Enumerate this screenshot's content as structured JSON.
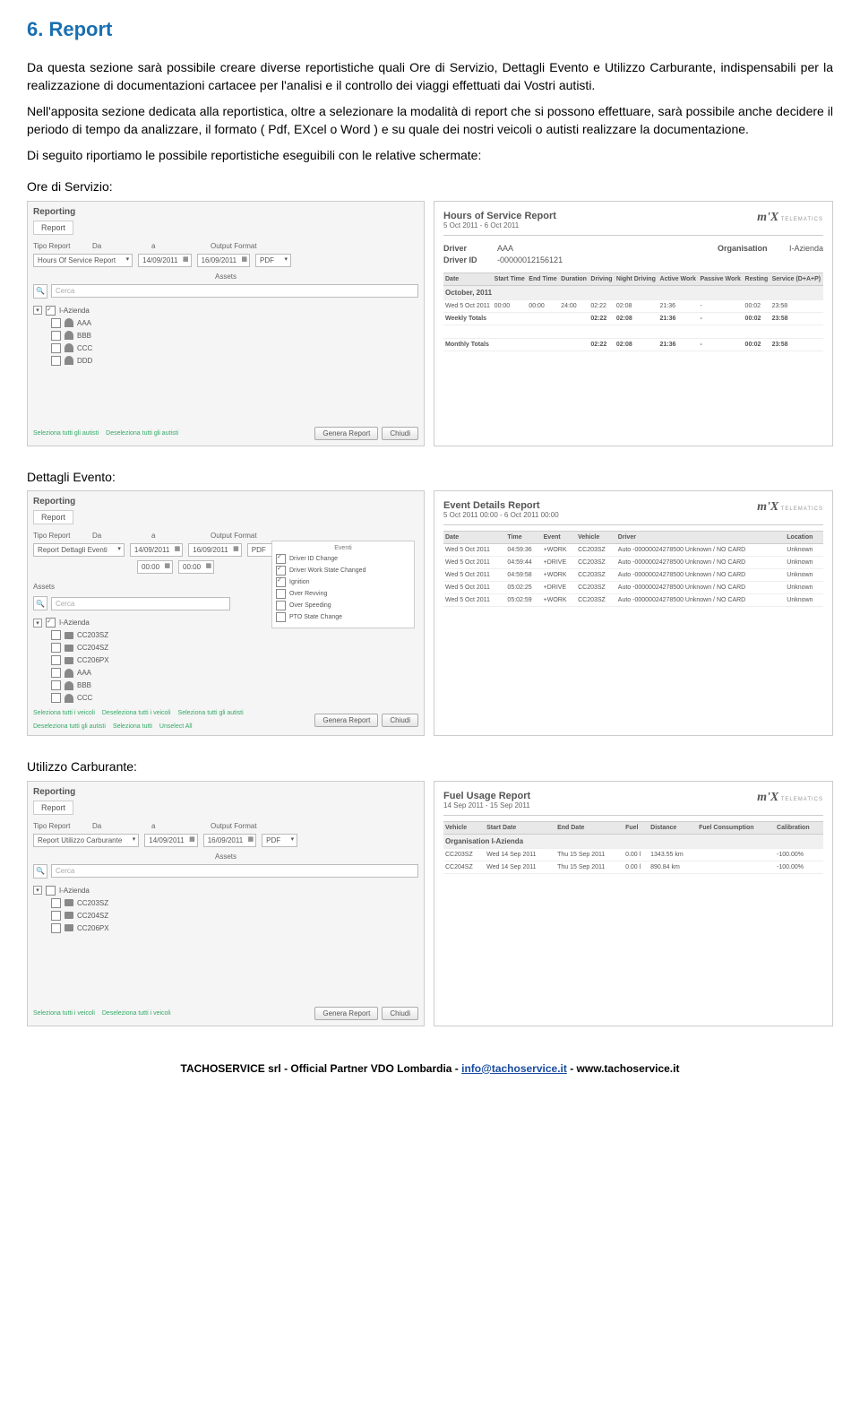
{
  "heading": "6. Report",
  "para1": "Da questa sezione sarà possibile creare diverse reportistiche quali Ore di Servizio, Dettagli Evento e Utilizzo Carburante, indispensabili per la realizzazione di documentazioni cartacee per l'analisi e il controllo dei viaggi effettuati dai Vostri autisti.",
  "para2": "Nell'apposita sezione dedicata alla reportistica, oltre a selezionare la modalità di report che si possono effettuare, sarà possibile anche decidere il periodo di tempo da analizzare, il formato ( Pdf, EXcel o Word ) e su quale dei nostri veicoli o autisti realizzare la documentazione.",
  "para3": "Di seguito riportiamo le possibile reportistiche eseguibili con le relative schermate:",
  "sections": {
    "ore": "Ore di Servizio:",
    "dettagli": "Dettagli Evento:",
    "carburante": "Utilizzo Carburante:"
  },
  "leftPanel": {
    "reporting": "Reporting",
    "tab": "Report",
    "tipoReport": "Tipo Report",
    "da": "Da",
    "a": "a",
    "outputFormat": "Output Format",
    "reportTypes": {
      "hours": "Hours Of Service Report",
      "events": "Report Dettagli Eventi",
      "fuel": "Report Utilizzo Carburante"
    },
    "date1": "14/09/2011",
    "date2": "16/09/2011",
    "time": "00:00",
    "pdf": "PDF",
    "assets": "Assets",
    "eventi": "Eventi",
    "cerca": "Cerca",
    "org": "I-Azienda",
    "drivers": [
      "AAA",
      "BBB",
      "CCC",
      "DDD"
    ],
    "vehicles": [
      "CC203SZ",
      "CC204SZ",
      "CC206PX"
    ],
    "evList": [
      "Driver ID Change",
      "Driver Work State Changed",
      "Ignition",
      "Over Revving",
      "Over Speeding",
      "PTO State Change"
    ],
    "buttons": {
      "selAuti": "Seleziona tutti gli autisti",
      "deselAuti": "Deseleziona tutti gli autisti",
      "selVeic": "Seleziona tutti i veicoli",
      "deselVeic": "Deseleziona tutti i veicoli",
      "selTutti": "Seleziona tutti",
      "unselAll": "Unselect All",
      "genera": "Genera Report",
      "chiudi": "Chiudi"
    }
  },
  "hoursReport": {
    "title": "Hours of Service Report",
    "range": "5 Oct 2011 - 6 Oct 2011",
    "driverLbl": "Driver",
    "driver": "AAA",
    "driverIdLbl": "Driver ID",
    "driverId": "-00000012156121",
    "orgLbl": "Organisation",
    "org": "I-Azienda",
    "cols": [
      "Date",
      "Start Time",
      "End Time",
      "Duration",
      "Driving",
      "Night Driving",
      "Active Work",
      "Passive Work",
      "Resting",
      "Service (D+A+P)"
    ],
    "month": "October, 2011",
    "row": [
      "Wed 5 Oct 2011",
      "00:00",
      "00:00",
      "24:00",
      "02:22",
      "02:08",
      "21:36",
      "-",
      "00:02",
      "23:58"
    ],
    "weekly": "Weekly Totals",
    "weeklyVals": [
      "",
      "",
      "",
      "02:22",
      "02:08",
      "21:36",
      "-",
      "00:02",
      "23:58"
    ],
    "monthly": "Monthly Totals",
    "monthlyVals": [
      "",
      "",
      "",
      "02:22",
      "02:08",
      "21:36",
      "-",
      "00:02",
      "23:58"
    ]
  },
  "eventsReport": {
    "title": "Event Details Report",
    "range": "5 Oct 2011 00:00 - 6 Oct 2011 00:00",
    "cols": [
      "Date",
      "Time",
      "Event",
      "Vehicle",
      "Driver",
      "Location"
    ],
    "rows": [
      [
        "Wed 5 Oct 2011",
        "04:59:36",
        "+WORK",
        "CC203SZ",
        "Auto -00000024278500 Unknown / NO CARD",
        "Unknown"
      ],
      [
        "Wed 5 Oct 2011",
        "04:59:44",
        "+DRIVE",
        "CC203SZ",
        "Auto -00000024278500 Unknown / NO CARD",
        "Unknown"
      ],
      [
        "Wed 5 Oct 2011",
        "04:59:58",
        "+WORK",
        "CC203SZ",
        "Auto -00000024278500 Unknown / NO CARD",
        "Unknown"
      ],
      [
        "Wed 5 Oct 2011",
        "05:02:25",
        "+DRIVE",
        "CC203SZ",
        "Auto -00000024278500 Unknown / NO CARD",
        "Unknown"
      ],
      [
        "Wed 5 Oct 2011",
        "05:02:59",
        "+WORK",
        "CC203SZ",
        "Auto -00000024278500 Unknown / NO CARD",
        "Unknown"
      ]
    ]
  },
  "fuelReport": {
    "title": "Fuel Usage Report",
    "range": "14 Sep 2011 - 15 Sep 2011",
    "cols": [
      "Vehicle",
      "Start Date",
      "End Date",
      "Fuel",
      "Distance",
      "Fuel Consumption",
      "Calibration"
    ],
    "orgLine": "Organisation  I-Azienda",
    "rows": [
      [
        "CC203SZ",
        "Wed 14 Sep 2011",
        "Thu 15 Sep 2011",
        "0.00 l",
        "1343.55 km",
        "",
        "-100.00%"
      ],
      [
        "CC204SZ",
        "Wed 14 Sep 2011",
        "Thu 15 Sep 2011",
        "0.00 l",
        "890.84 km",
        "",
        "-100.00%"
      ]
    ]
  },
  "logo": {
    "main": "m'X",
    "sub": "TELEMATICS"
  },
  "footer": {
    "text1": "TACHOSERVICE srl - Official Partner VDO Lombardia  - ",
    "email": "info@tachoservice.it",
    "text2": " - www.tachoservice.it"
  }
}
